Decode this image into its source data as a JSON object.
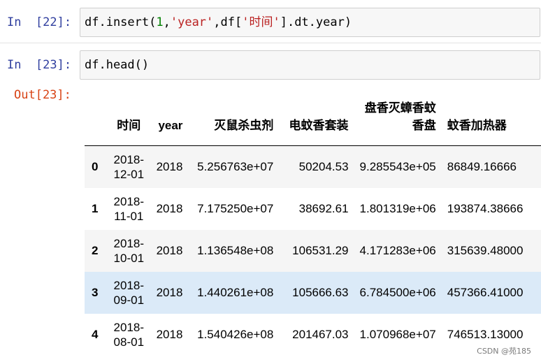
{
  "cells": [
    {
      "prompt": "In  [22]:",
      "code_parts": [
        "df.insert(",
        "1",
        ",",
        "'year'",
        ",df[",
        "'时间'",
        "].dt.year)"
      ]
    },
    {
      "prompt": "In  [23]:",
      "code": "df.head()"
    }
  ],
  "output_prompt": "Out[23]:",
  "table": {
    "columns": [
      "",
      "时间",
      "year",
      "灭鼠杀虫剂",
      "电蚊香套装",
      "盘香灭蟑香蚊香盘",
      "蚊香加热器"
    ],
    "rows": [
      {
        "index": "0",
        "date_line1": "2018-",
        "date_line2": "12-01",
        "year": "2018",
        "c1": "5.256763e+07",
        "c2": "50204.53",
        "c3": "9.285543e+05",
        "c4": "86849.16666"
      },
      {
        "index": "1",
        "date_line1": "2018-",
        "date_line2": "11-01",
        "year": "2018",
        "c1": "7.175250e+07",
        "c2": "38692.61",
        "c3": "1.801319e+06",
        "c4": "193874.38666"
      },
      {
        "index": "2",
        "date_line1": "2018-",
        "date_line2": "10-01",
        "year": "2018",
        "c1": "1.136548e+08",
        "c2": "106531.29",
        "c3": "4.171283e+06",
        "c4": "315639.48000"
      },
      {
        "index": "3",
        "date_line1": "2018-",
        "date_line2": "09-01",
        "year": "2018",
        "c1": "1.440261e+08",
        "c2": "105666.63",
        "c3": "6.784500e+06",
        "c4": "457366.41000"
      },
      {
        "index": "4",
        "date_line1": "2018-",
        "date_line2": "08-01",
        "year": "2018",
        "c1": "1.540426e+08",
        "c2": "201467.03",
        "c3": "1.070968e+07",
        "c4": "746513.13000"
      }
    ]
  },
  "watermark": "CSDN @苑185"
}
